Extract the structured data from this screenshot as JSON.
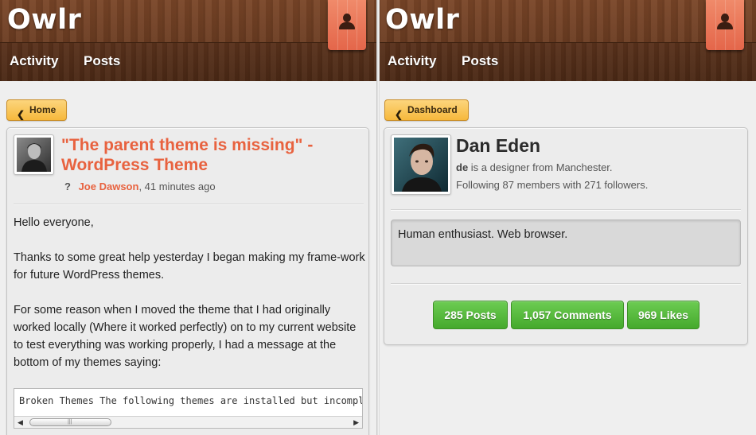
{
  "left_screen": {
    "app_title": "Owlr",
    "nav": {
      "activity": "Activity",
      "posts": "Posts"
    },
    "back_button": "Home",
    "post": {
      "title": "\"The parent theme is missing\" - WordPress Theme",
      "meta_icon": "?",
      "author": "Joe Dawson",
      "time": ", 41 minutes ago",
      "paragraphs": [
        "Hello everyone,",
        "Thanks to some great help yesterday I began making my frame-work for future WordPress themes.",
        "For some reason when I moved the theme that I had originally worked locally (Where it worked perfectly) on to my current website to test everything was working properly, I had a message at the bottom of my themes saying:"
      ],
      "code": "Broken Themes The following themes are installed but incomplete."
    }
  },
  "right_screen": {
    "app_title": "Owlr",
    "nav": {
      "activity": "Activity",
      "posts": "Posts"
    },
    "back_button": "Dashboard",
    "profile": {
      "name": "Dan Eden",
      "username": "de",
      "description": " is a designer from Manchester.",
      "following": "Following 87 members with 271 followers.",
      "bio": "Human enthusiast. Web browser.",
      "stats": {
        "posts": "285 Posts",
        "comments": "1,057 Comments",
        "likes": "969 Likes"
      }
    }
  },
  "colors": {
    "accent": "#e8623f",
    "wood": "#6b3c21",
    "back_button": "#f6b83c",
    "stat_button": "#45a92c"
  },
  "icons": [
    "user-icon",
    "chevron-left-icon",
    "scroll-left-icon",
    "scroll-right-icon"
  ]
}
